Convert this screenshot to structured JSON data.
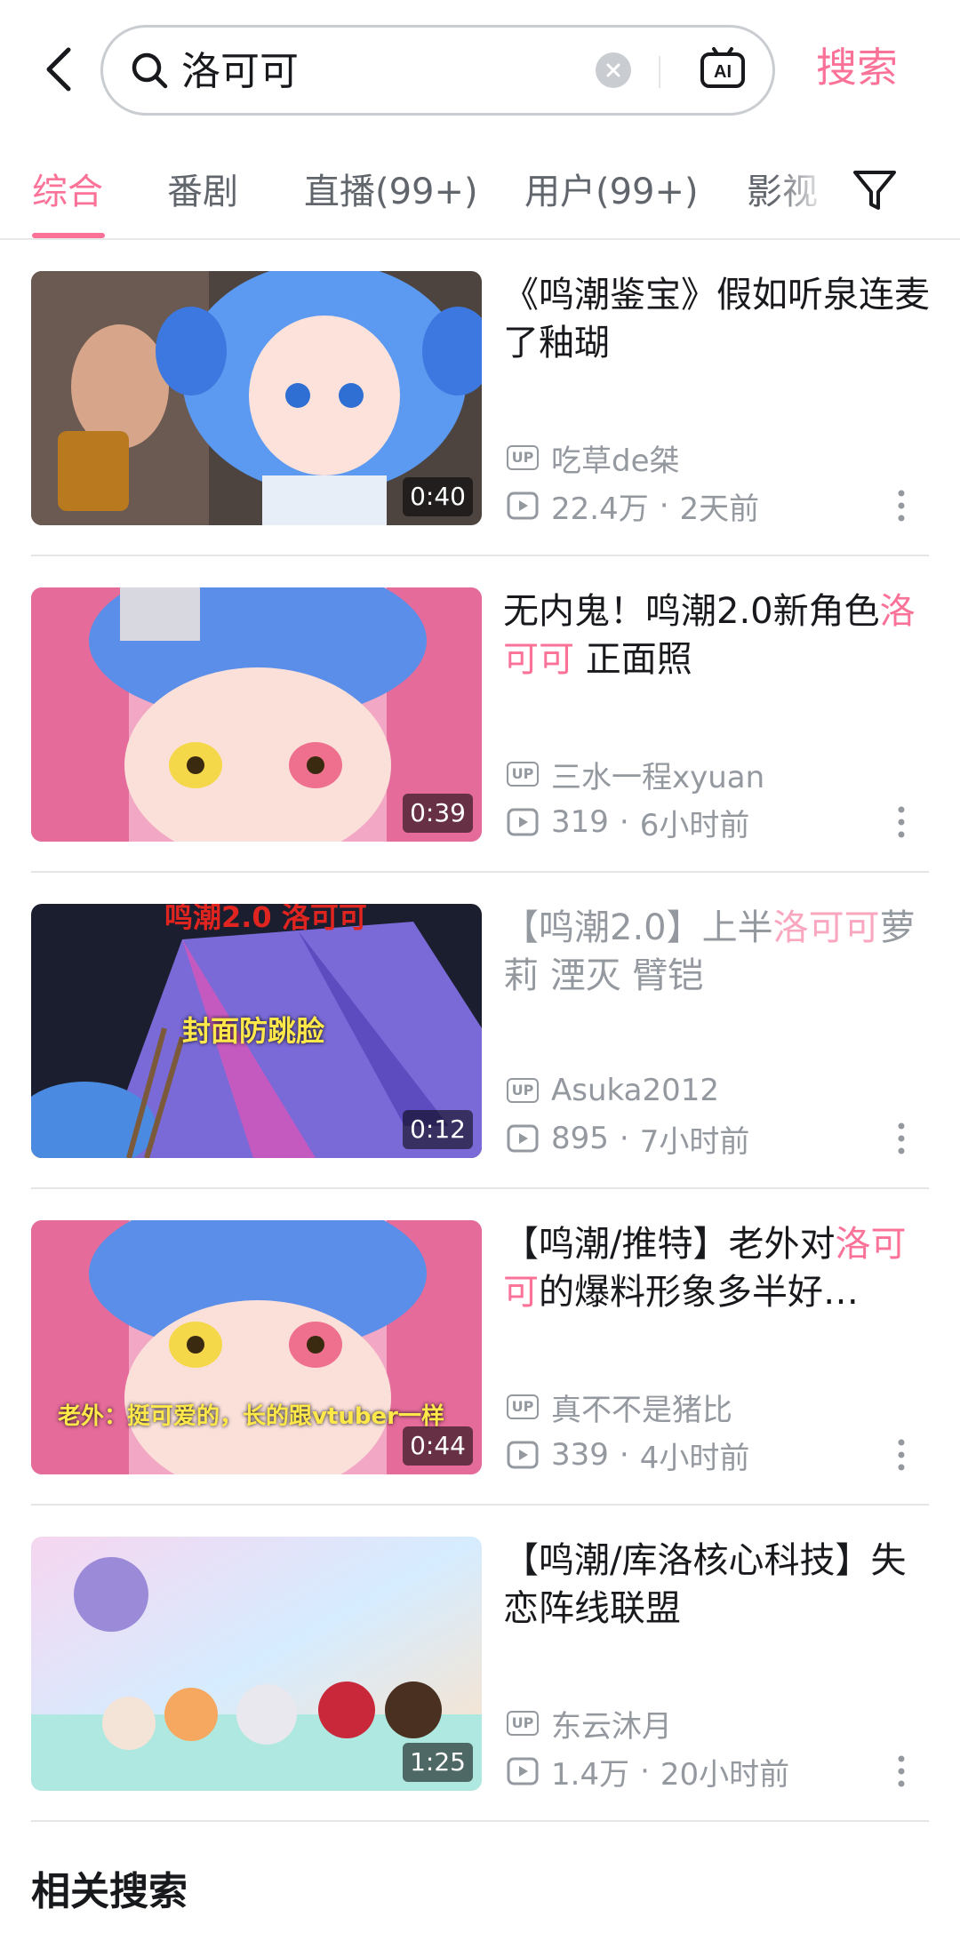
{
  "search": {
    "query": "洛可可",
    "submit_label": "搜索"
  },
  "tabs": [
    {
      "label": "综合",
      "active": true
    },
    {
      "label": "番剧",
      "active": false
    },
    {
      "label": "直播(99+)",
      "active": false
    },
    {
      "label": "用户(99+)",
      "active": false
    },
    {
      "label": "影视",
      "active": false
    }
  ],
  "results": [
    {
      "title_pre": "《鸣潮鉴宝》假如听泉连麦了釉瑚",
      "title_hl": "",
      "title_post": "",
      "up": "吃草de桀",
      "views": "22.4万",
      "time": "2天前",
      "duration": "0:40",
      "thumb_colors": [
        "#3a4a8c",
        "#6ab0ff",
        "#f5d1c8"
      ]
    },
    {
      "title_pre": "无内鬼！鸣潮2.0新角色",
      "title_hl": "洛可可",
      "title_post": " 正面照",
      "up": "三水一程xyuan",
      "views": "319",
      "time": "6小时前",
      "duration": "0:39",
      "thumb_colors": [
        "#e56b9a",
        "#5b8ee8",
        "#f8d8d4"
      ]
    },
    {
      "title_pre": "【鸣潮2.0】上半",
      "title_hl": "洛可可",
      "title_post": "萝莉 湮灭 臂铠",
      "up": "Asuka2012",
      "views": "895",
      "time": "7小时前",
      "duration": "0:12",
      "overlay_text": "封面防跳脸",
      "top_text": "鸣潮2.0 洛可可",
      "thumb_colors": [
        "#1b1e2e",
        "#7a6ad8",
        "#c45ac0"
      ]
    },
    {
      "title_pre": "【鸣潮/推特】老外对",
      "title_hl": "洛可可",
      "title_post": "的爆料形象多半好…",
      "up": "真不不是猪比",
      "views": "339",
      "time": "4小时前",
      "duration": "0:44",
      "overlay_text": "老外：挺可爱的，长的跟vtuber一样",
      "thumb_colors": [
        "#e56b9a",
        "#5b8ee8",
        "#f8d8d4"
      ]
    },
    {
      "title_pre": "【鸣潮/库洛核心科技】失恋阵线联盟",
      "title_hl": "",
      "title_post": "",
      "up": "东云沐月",
      "views": "1.4万",
      "time": "20小时前",
      "duration": "1:25",
      "thumb_colors": [
        "#f6d6f0",
        "#b8e6ff",
        "#ffd7a8"
      ]
    }
  ],
  "related_heading": "相关搜索",
  "colors": {
    "accent": "#fb7299",
    "muted": "#9499a0"
  }
}
